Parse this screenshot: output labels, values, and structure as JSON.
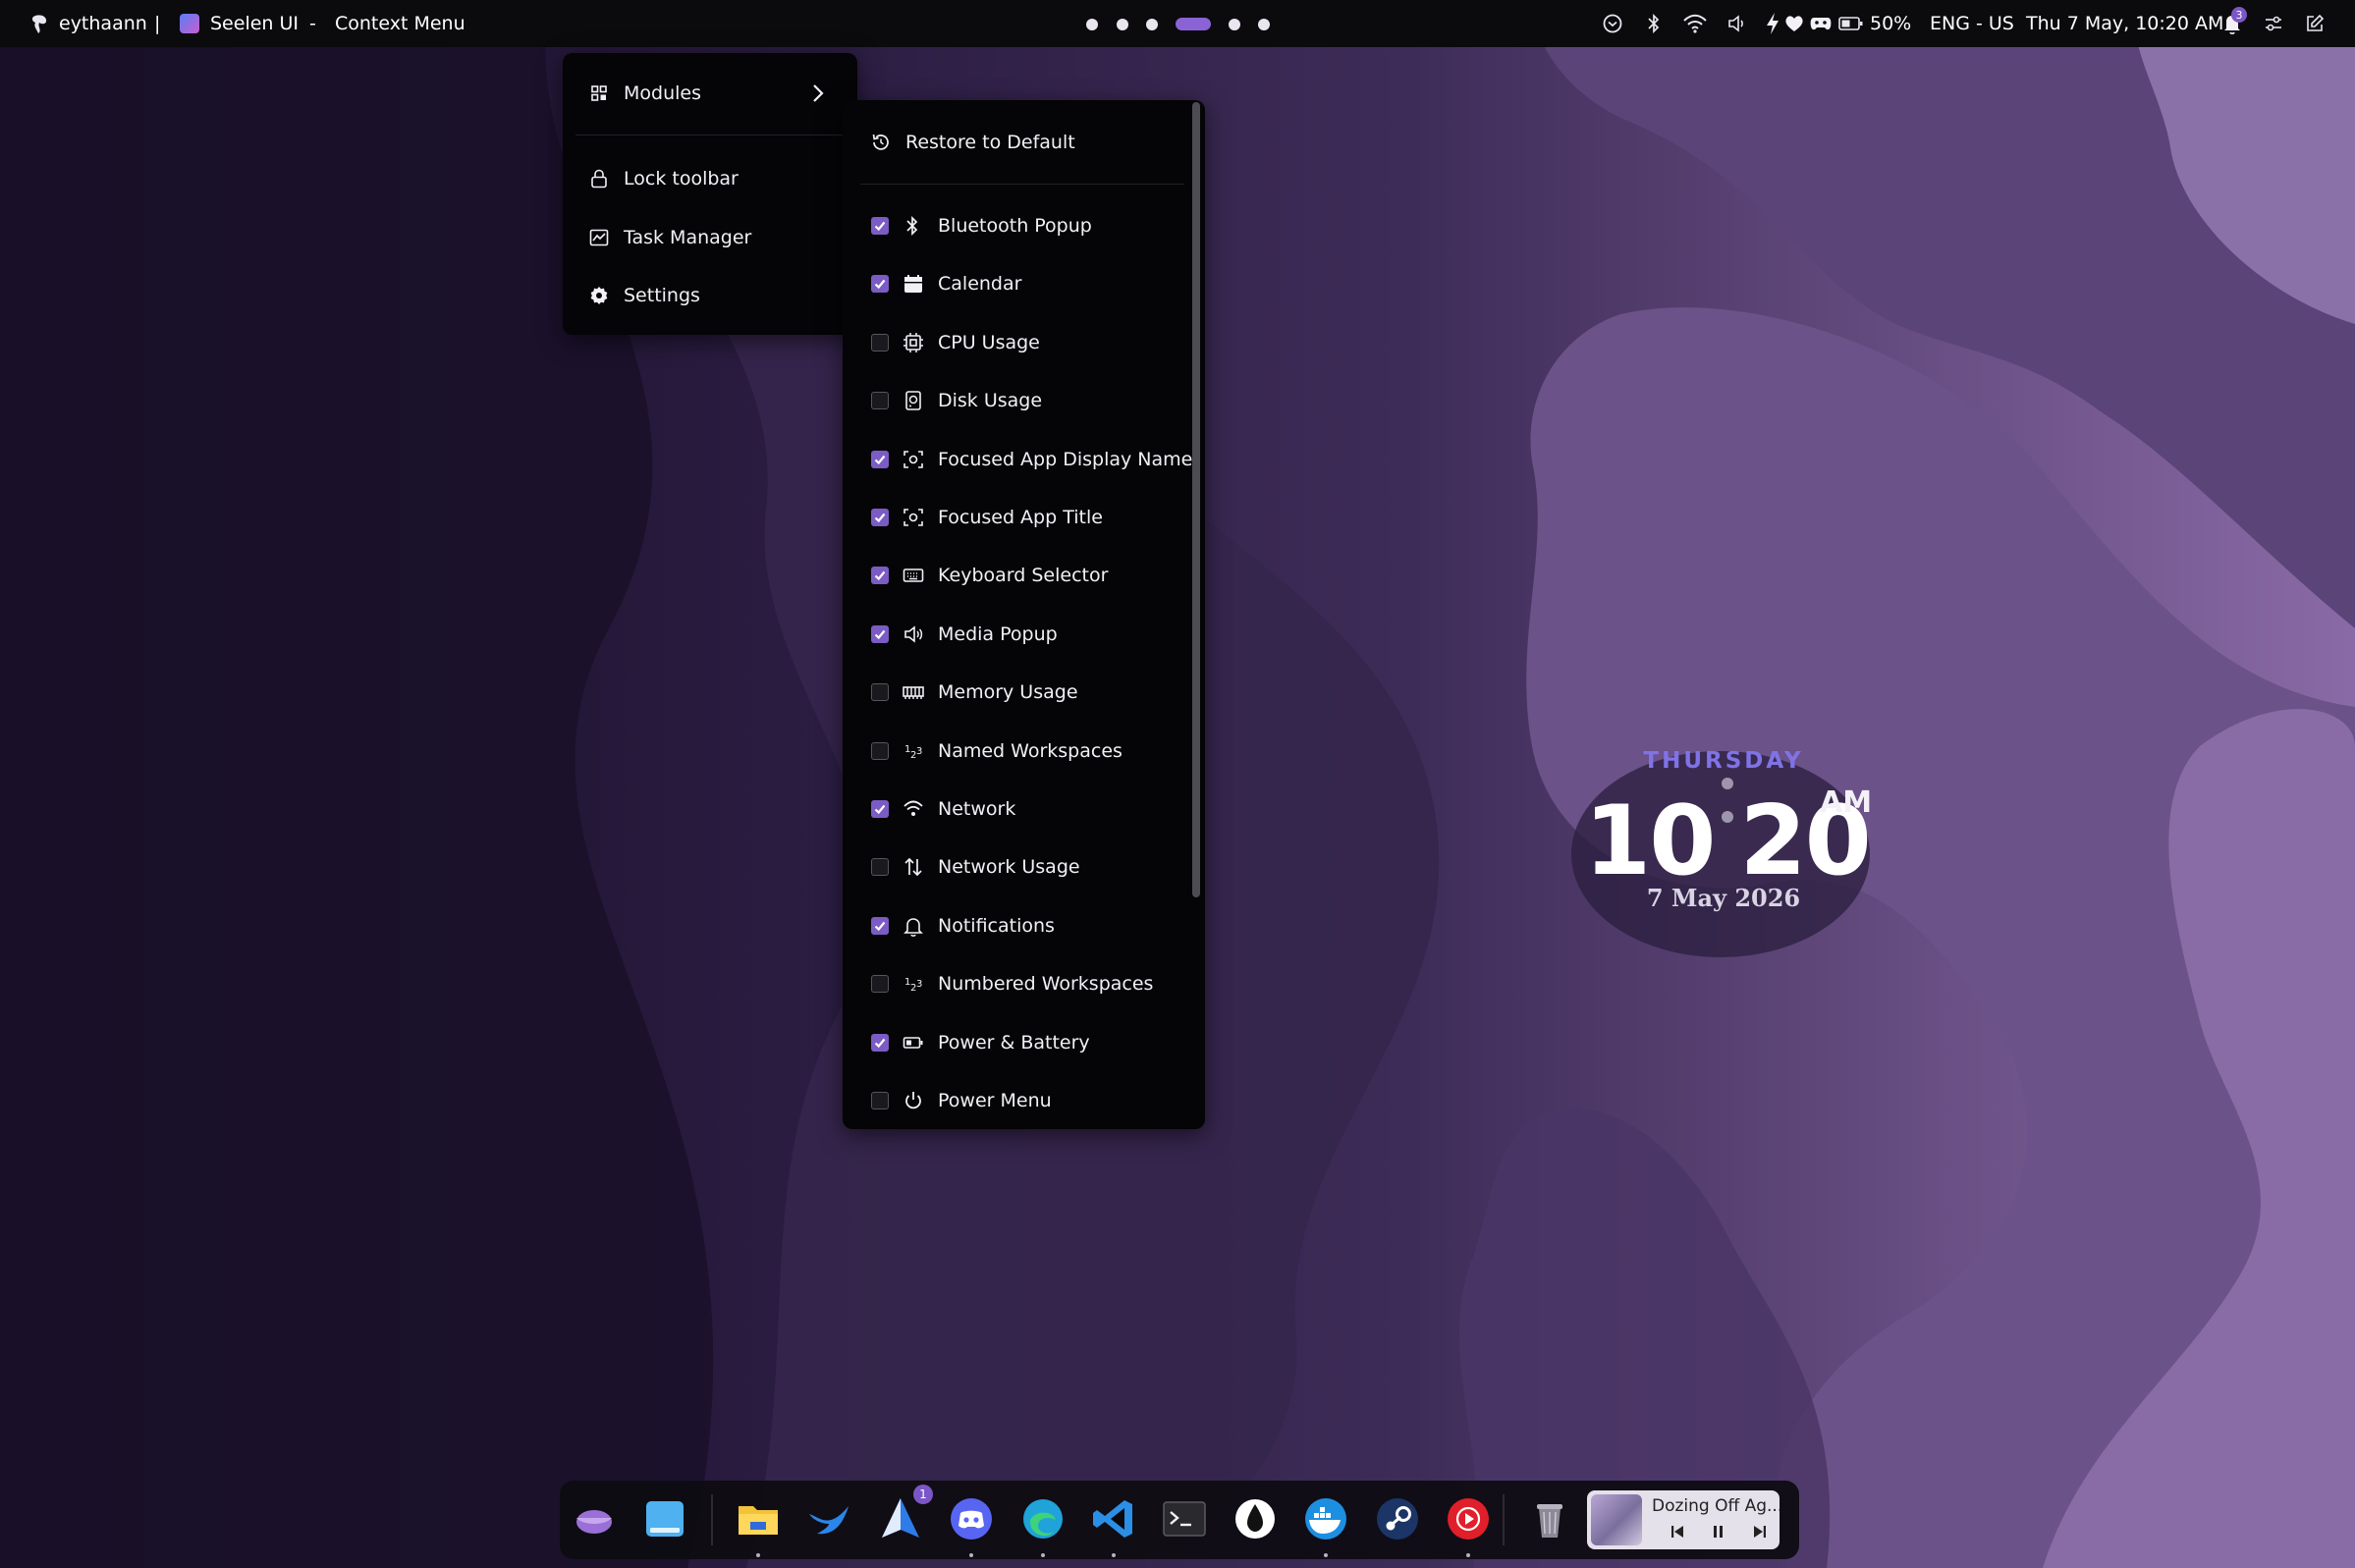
{
  "topbar": {
    "user": "eythaann",
    "separator1": "|",
    "app_name": "Seelen UI",
    "separator2": "-",
    "window_title": "Context Menu",
    "battery": "50%",
    "language": "ENG - US",
    "datetime": "Thu 7 May, 10:20 AM",
    "notification_count": "3",
    "workspaces": {
      "count": 6,
      "active_index": 3
    }
  },
  "main_menu": {
    "items": [
      {
        "label": "Modules",
        "icon": "grid-icon",
        "has_submenu": true
      },
      {
        "label": "Lock toolbar",
        "icon": "lock-icon"
      },
      {
        "label": "Task Manager",
        "icon": "task-manager-icon"
      },
      {
        "label": "Settings",
        "icon": "gear-icon"
      }
    ]
  },
  "modules_menu": {
    "restore_label": "Restore to Default",
    "items": [
      {
        "label": "Bluetooth Popup",
        "checked": true,
        "icon": "bluetooth-icon"
      },
      {
        "label": "Calendar",
        "checked": true,
        "icon": "calendar-icon"
      },
      {
        "label": "CPU Usage",
        "checked": false,
        "icon": "cpu-icon"
      },
      {
        "label": "Disk Usage",
        "checked": false,
        "icon": "disk-icon"
      },
      {
        "label": "Focused App Display Name",
        "checked": true,
        "icon": "focus-icon"
      },
      {
        "label": "Focused App Title",
        "checked": true,
        "icon": "focus-icon"
      },
      {
        "label": "Keyboard Selector",
        "checked": true,
        "icon": "keyboard-icon"
      },
      {
        "label": "Media Popup",
        "checked": true,
        "icon": "speaker-icon"
      },
      {
        "label": "Memory Usage",
        "checked": false,
        "icon": "memory-icon"
      },
      {
        "label": "Named Workspaces",
        "checked": false,
        "icon": "workspaces-icon"
      },
      {
        "label": "Network",
        "checked": true,
        "icon": "wifi-icon"
      },
      {
        "label": "Network Usage",
        "checked": false,
        "icon": "arrows-updown-icon"
      },
      {
        "label": "Notifications",
        "checked": true,
        "icon": "bell-icon"
      },
      {
        "label": "Numbered Workspaces",
        "checked": false,
        "icon": "workspaces-icon"
      },
      {
        "label": "Power & Battery",
        "checked": true,
        "icon": "battery-icon"
      },
      {
        "label": "Power Menu",
        "checked": false,
        "icon": "power-icon"
      }
    ]
  },
  "clock": {
    "day": "THURSDAY",
    "hour": "10",
    "minute": "20",
    "ampm": "AM",
    "date": "7 May 2026"
  },
  "dock": {
    "apps": [
      {
        "name": "seelen-app",
        "color": "#9a6fd6"
      },
      {
        "name": "desktop-app",
        "color": "#4fb1ef"
      },
      {
        "name": "file-explorer",
        "color": "#f2c23a"
      },
      {
        "name": "bird-app",
        "color": "#2a86e8"
      },
      {
        "name": "send-app",
        "color": "#2f7be8",
        "badge": "1"
      },
      {
        "name": "discord",
        "color": "#5865f2"
      },
      {
        "name": "edge",
        "color": "#1fa3d8"
      },
      {
        "name": "vscode",
        "color": "#2b8fe5"
      },
      {
        "name": "terminal",
        "color": "#2a2a2e"
      },
      {
        "name": "inkdrop-app",
        "color": "#ffffff"
      },
      {
        "name": "docker",
        "color": "#1d8fe0"
      },
      {
        "name": "steam",
        "color": "#1b3566"
      },
      {
        "name": "youtube-music",
        "color": "#e01f2a"
      },
      {
        "name": "recycle-bin",
        "color": "#8d8a98"
      }
    ],
    "media_title": "Dozing Off Ag..."
  },
  "colors": {
    "accent": "#7b5cc4",
    "clock_day": "#7f73e6",
    "menu_bg": "#050406"
  }
}
